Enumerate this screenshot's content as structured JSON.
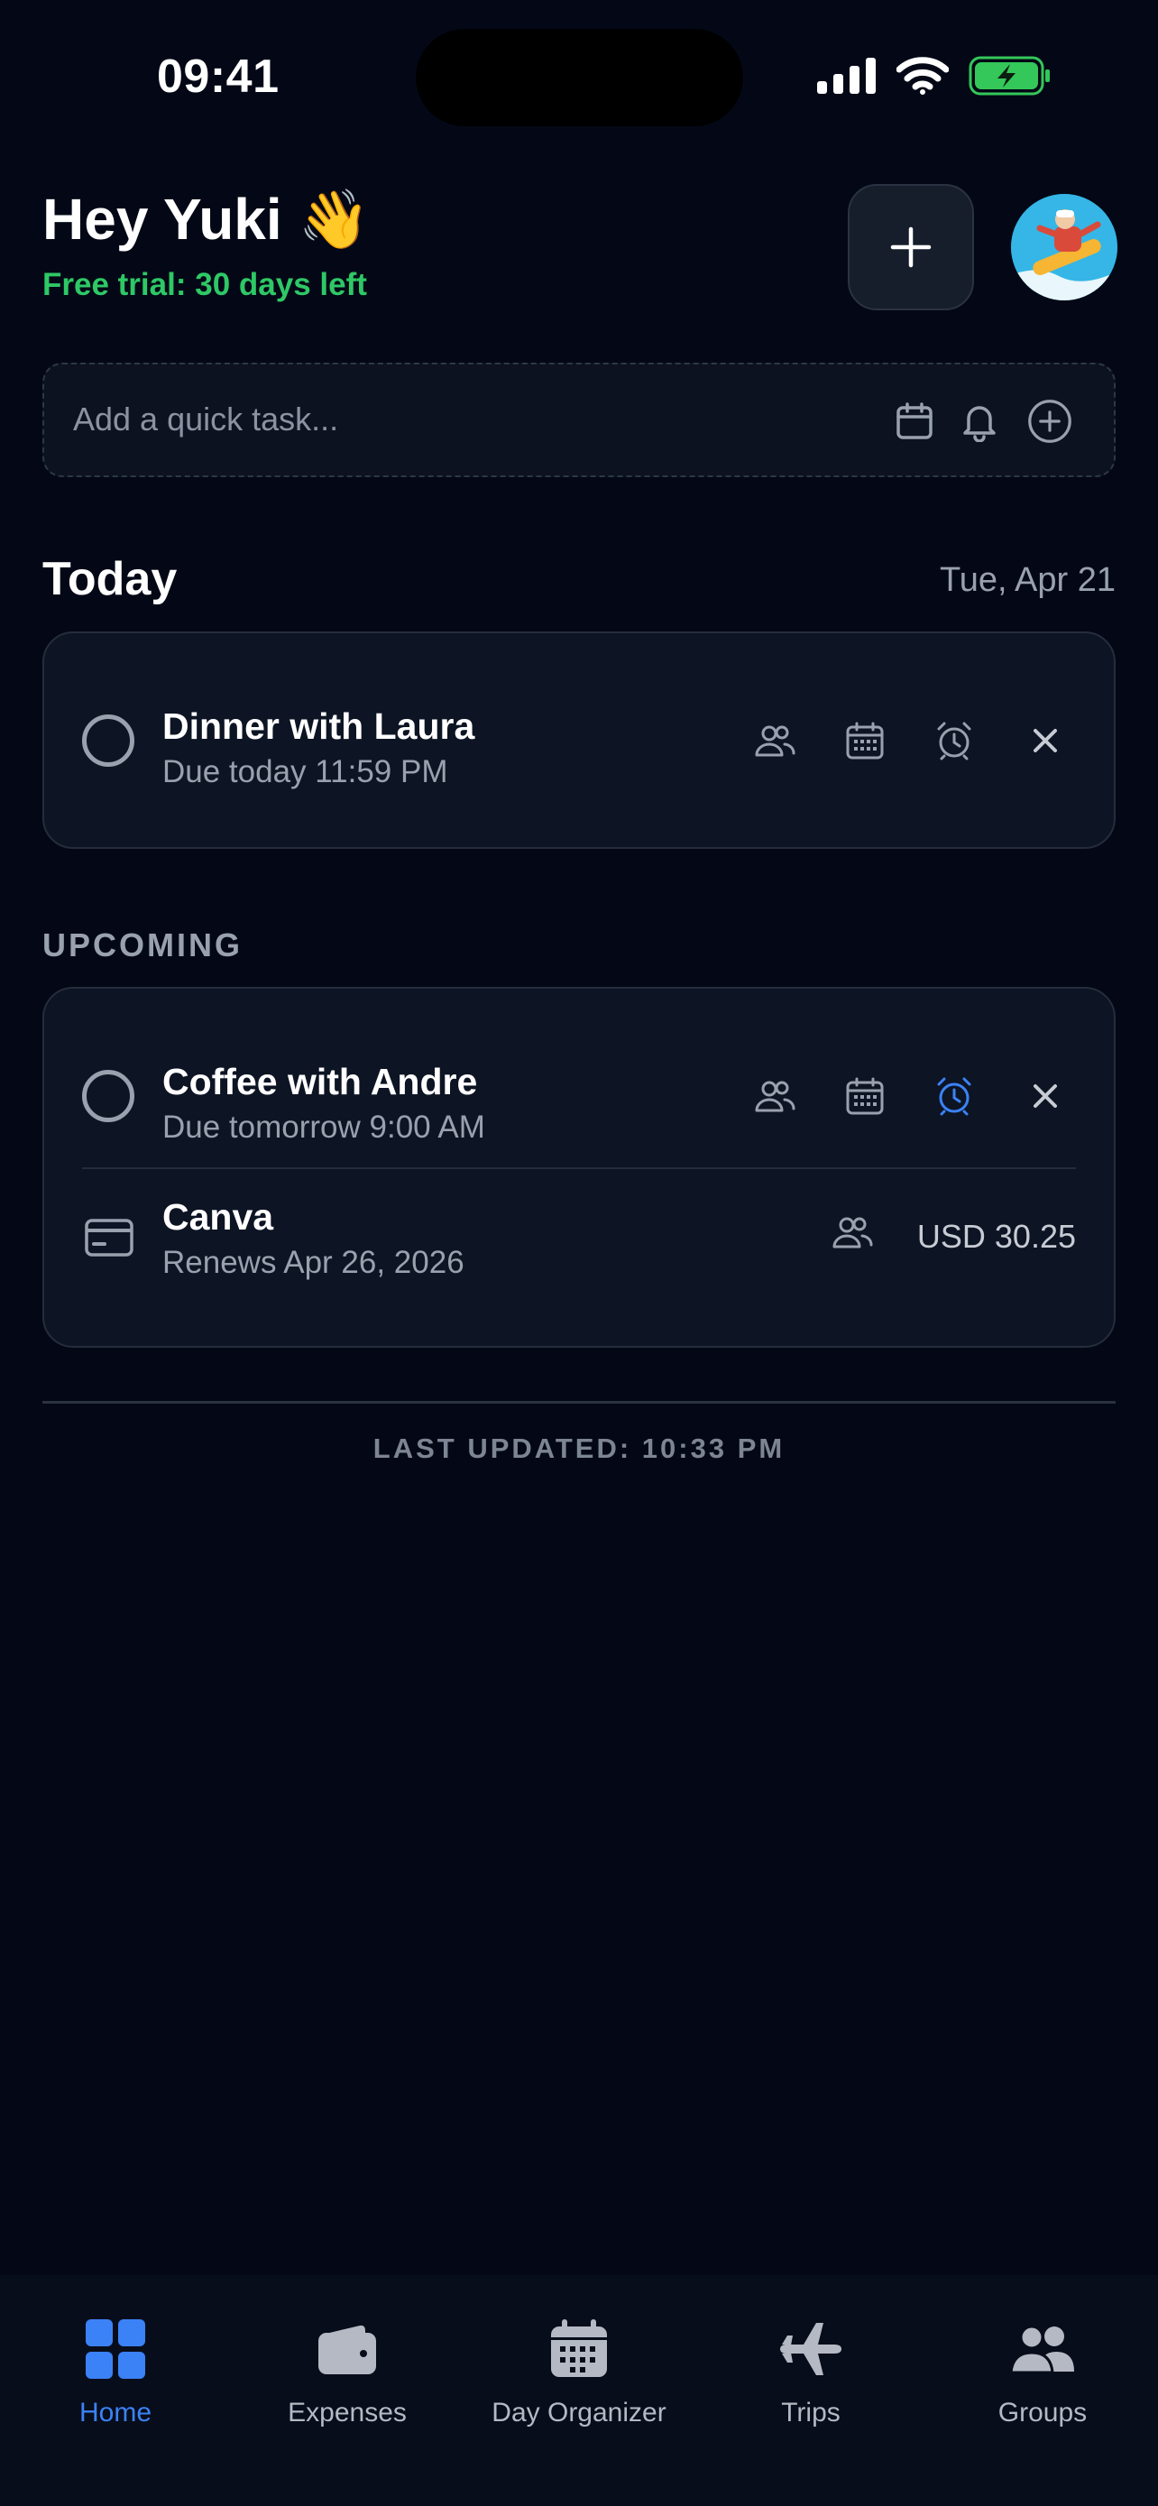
{
  "status_bar": {
    "time": "09:41"
  },
  "header": {
    "greeting": "Hey Yuki 👋",
    "trial": "Free trial: 30 days left"
  },
  "quick_task": {
    "placeholder": "Add a quick task..."
  },
  "today": {
    "title": "Today",
    "date": "Tue, Apr 21",
    "tasks": [
      {
        "title": "Dinner with Laura",
        "due": "Due today 11:59 PM"
      }
    ]
  },
  "upcoming": {
    "label": "UPCOMING",
    "tasks": [
      {
        "title": "Coffee with Andre",
        "due": "Due tomorrow 9:00 AM",
        "alarm_active": true
      }
    ],
    "subscriptions": [
      {
        "name": "Canva",
        "renews": "Renews Apr 26, 2026",
        "amount": "USD 30.25"
      }
    ]
  },
  "footer": {
    "last_updated": "LAST UPDATED: 10:33 PM"
  },
  "nav": {
    "items": [
      {
        "label": "Home",
        "icon": "grid-icon",
        "active": true
      },
      {
        "label": "Expenses",
        "icon": "wallet-icon"
      },
      {
        "label": "Day Organizer",
        "icon": "calendar-icon"
      },
      {
        "label": "Trips",
        "icon": "plane-icon"
      },
      {
        "label": "Groups",
        "icon": "people-icon"
      }
    ]
  },
  "colors": {
    "background": "#040816",
    "accent": "#3b82f6",
    "trial_green": "#2ec866",
    "battery_green": "#34c759"
  }
}
